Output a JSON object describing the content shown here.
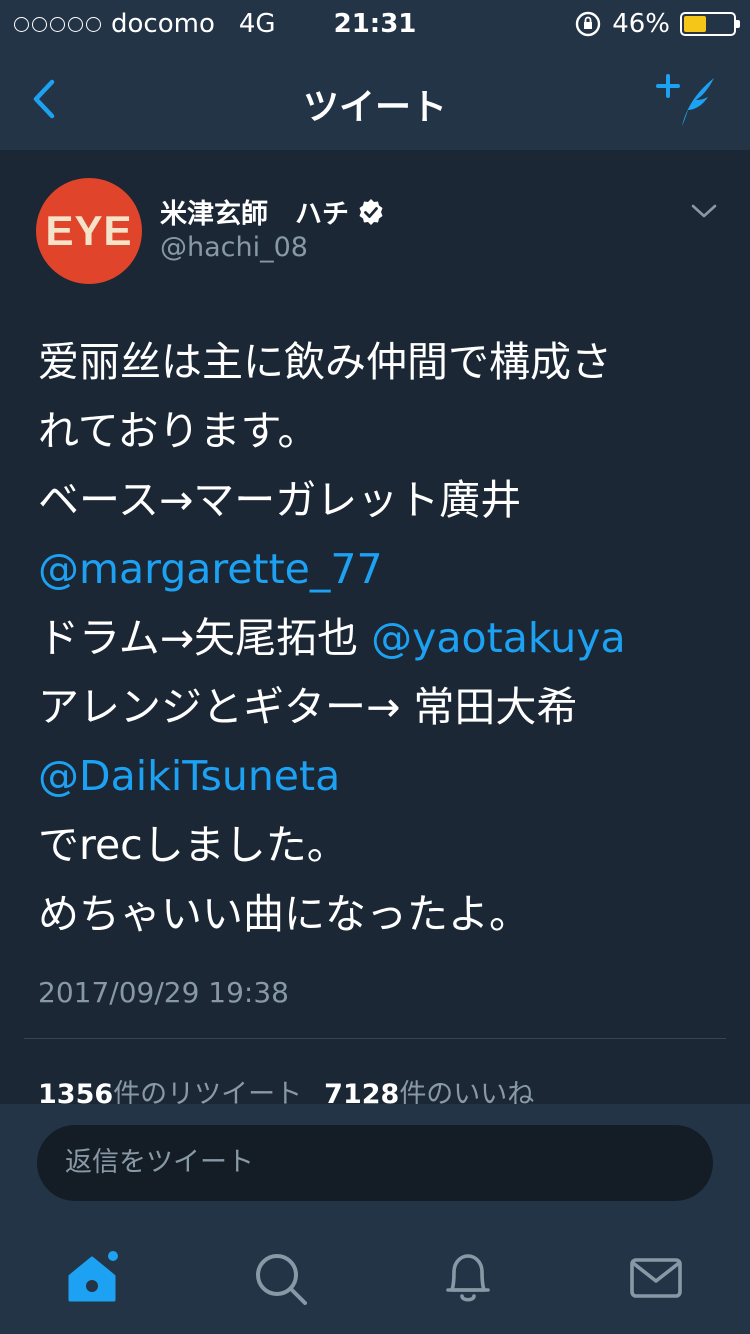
{
  "status_bar": {
    "carrier": "docomo",
    "network": "4G",
    "time": "21:31",
    "battery_percent": "46%",
    "battery_level": 0.46
  },
  "nav": {
    "title": "ツイート"
  },
  "tweet": {
    "display_name": "米津玄師　ハチ",
    "handle": "@hachi_08",
    "avatar_text": "EYE",
    "lines": [
      "爱丽丝は主に飲み仲間で構成さ",
      "れております。",
      "ベース→マーガレット廣井",
      "@margarette_77",
      "ドラム→矢尾拓也 ",
      "@yaotakuya",
      "アレンジとギター→ 常田大希",
      "@DaikiTsuneta",
      "でrecしました。",
      "めちゃいい曲になったよ。"
    ],
    "timestamp": "2017/09/29 19:38",
    "retweet_count": "1356",
    "retweet_label": "件のリツイート",
    "like_count": "7128",
    "like_label": "件のいいね"
  },
  "reply": {
    "placeholder": "返信をツイート"
  },
  "colors": {
    "accent": "#1da1f2",
    "background": "#1b2735",
    "bar": "#243447",
    "muted": "#8899a6"
  },
  "tabs": [
    "home-icon",
    "search-icon",
    "bell-icon",
    "mail-icon"
  ]
}
